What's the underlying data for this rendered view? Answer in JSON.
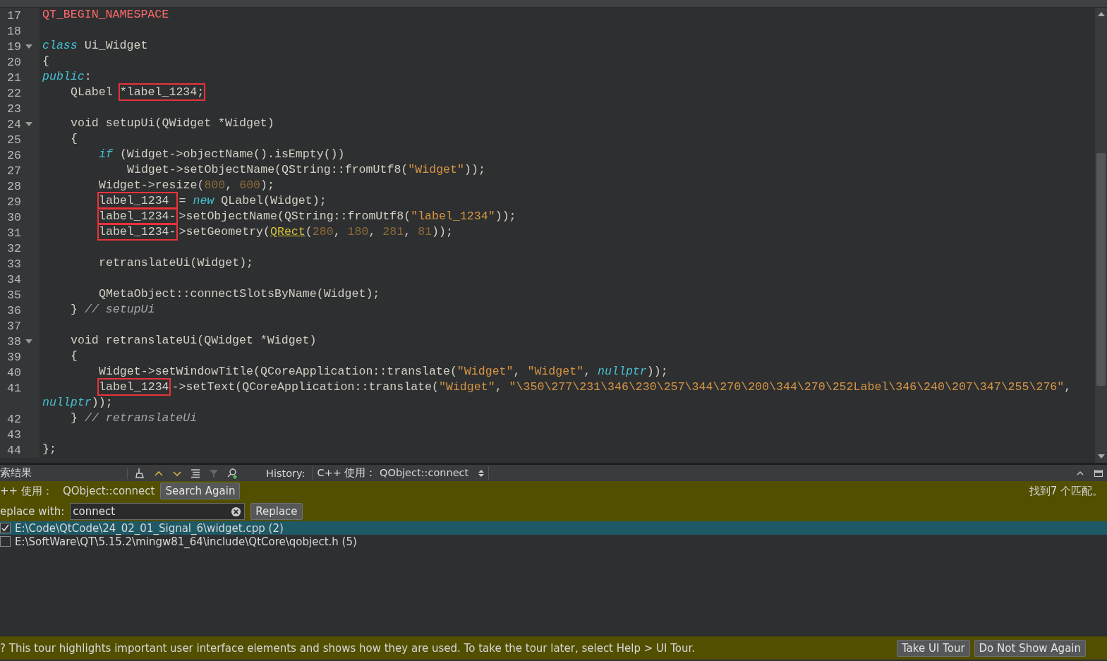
{
  "editor": {
    "lines": [
      {
        "number": "17",
        "foldable": false,
        "kind": "top",
        "tokens": [
          {
            "text": "QT_BEGIN_NAMESPACE",
            "kind": "macro"
          }
        ]
      },
      {
        "number": "18",
        "foldable": false
      },
      {
        "number": "19",
        "foldable": true,
        "kind": "top",
        "tokens": [
          {
            "text": "class",
            "kind": "keyword"
          },
          {
            "text": " Ui_Widget",
            "kind": "plain"
          }
        ]
      },
      {
        "number": "20",
        "foldable": false,
        "kind": "top",
        "tokens": [
          {
            "text": "{",
            "kind": "plain"
          }
        ]
      },
      {
        "number": "21",
        "foldable": false,
        "kind": "top",
        "tokens": [
          {
            "text": "public",
            "kind": "keyword"
          },
          {
            "text": ":",
            "kind": "plain"
          }
        ]
      },
      {
        "number": "22",
        "foldable": false,
        "kind": "member",
        "tokens": [
          {
            "text": "QLabel ",
            "kind": "plain"
          },
          {
            "text": "*label_1234;",
            "kind": "plain",
            "boxed": true
          }
        ]
      },
      {
        "number": "23",
        "foldable": false
      },
      {
        "number": "24",
        "foldable": true,
        "kind": "member",
        "tokens": [
          {
            "text": "void setupUi(QWidget *Widget)",
            "kind": "plain"
          }
        ]
      },
      {
        "number": "25",
        "foldable": false,
        "kind": "member",
        "tokens": [
          {
            "text": "{",
            "kind": "plain"
          }
        ]
      },
      {
        "number": "26",
        "foldable": false,
        "kind": "body",
        "tokens": [
          {
            "text": "if",
            "kind": "keyword"
          },
          {
            "text": " (Widget->objectName().isEmpty())",
            "kind": "plain"
          }
        ]
      },
      {
        "number": "27",
        "foldable": false,
        "kind": "nested",
        "tokens": [
          {
            "text": "Widget->setObjectName(QString::fromUtf8(",
            "kind": "plain"
          },
          {
            "text": "\"Widget\"",
            "kind": "string"
          },
          {
            "text": "));",
            "kind": "plain"
          }
        ]
      },
      {
        "number": "28",
        "foldable": false,
        "kind": "body",
        "tokens": [
          {
            "text": "Widget->resize(",
            "kind": "plain"
          },
          {
            "text": "800",
            "kind": "number"
          },
          {
            "text": ", ",
            "kind": "plain"
          },
          {
            "text": "600",
            "kind": "number"
          },
          {
            "text": ");",
            "kind": "plain"
          }
        ]
      },
      {
        "number": "29",
        "foldable": false,
        "kind": "body",
        "tokens": [
          {
            "text": "label_1234 ",
            "kind": "plain",
            "boxed": true
          },
          {
            "text": "= ",
            "kind": "plain"
          },
          {
            "text": "new",
            "kind": "keyword"
          },
          {
            "text": " QLabel(Widget);",
            "kind": "plain"
          }
        ]
      },
      {
        "number": "30",
        "foldable": false,
        "kind": "body",
        "tokens": [
          {
            "text": "label_1234-",
            "kind": "plain",
            "boxed": true
          },
          {
            "text": ">setObjectName(QString::fromUtf8(",
            "kind": "plain"
          },
          {
            "text": "\"label_1234\"",
            "kind": "string"
          },
          {
            "text": "));",
            "kind": "plain"
          }
        ]
      },
      {
        "number": "31",
        "foldable": false,
        "kind": "body",
        "tokens": [
          {
            "text": "label_1234-",
            "kind": "plain",
            "boxed": true
          },
          {
            "text": ">setGeometry(",
            "kind": "plain"
          },
          {
            "text": "QRect",
            "kind": "link"
          },
          {
            "text": "(",
            "kind": "plain"
          },
          {
            "text": "280",
            "kind": "number"
          },
          {
            "text": ", ",
            "kind": "plain"
          },
          {
            "text": "180",
            "kind": "number"
          },
          {
            "text": ", ",
            "kind": "plain"
          },
          {
            "text": "281",
            "kind": "number"
          },
          {
            "text": ", ",
            "kind": "plain"
          },
          {
            "text": "81",
            "kind": "number"
          },
          {
            "text": "));",
            "kind": "plain"
          }
        ]
      },
      {
        "number": "32",
        "foldable": false
      },
      {
        "number": "33",
        "foldable": false,
        "kind": "body",
        "tokens": [
          {
            "text": "retranslateUi(Widget);",
            "kind": "plain"
          }
        ]
      },
      {
        "number": "34",
        "foldable": false
      },
      {
        "number": "35",
        "foldable": false,
        "kind": "body",
        "tokens": [
          {
            "text": "QMetaObject::connectSlotsByName(Widget);",
            "kind": "plain"
          }
        ]
      },
      {
        "number": "36",
        "foldable": false,
        "kind": "member",
        "tokens": [
          {
            "text": "} ",
            "kind": "plain"
          },
          {
            "text": "// setupUi",
            "kind": "comment"
          }
        ]
      },
      {
        "number": "37",
        "foldable": false
      },
      {
        "number": "38",
        "foldable": true,
        "kind": "member",
        "tokens": [
          {
            "text": "void retranslateUi(QWidget *Widget)",
            "kind": "plain"
          }
        ]
      },
      {
        "number": "39",
        "foldable": false,
        "kind": "member",
        "tokens": [
          {
            "text": "{",
            "kind": "plain"
          }
        ]
      },
      {
        "number": "40",
        "foldable": false,
        "kind": "body",
        "tokens": [
          {
            "text": "Widget->setWindowTitle(QCoreApplication::translate(",
            "kind": "plain"
          },
          {
            "text": "\"Widget\"",
            "kind": "string"
          },
          {
            "text": ", ",
            "kind": "plain"
          },
          {
            "text": "\"Widget\"",
            "kind": "string"
          },
          {
            "text": ", ",
            "kind": "plain"
          },
          {
            "text": "nullptr",
            "kind": "keyword"
          },
          {
            "text": "));",
            "kind": "plain"
          }
        ]
      },
      {
        "number": "41",
        "foldable": false,
        "kind": "body",
        "tokens": [
          {
            "text": "label_1234",
            "kind": "plain",
            "boxed": true
          },
          {
            "text": "->setText(QCoreApplication::translate(",
            "kind": "plain"
          },
          {
            "text": "\"Widget\"",
            "kind": "string"
          },
          {
            "text": ", ",
            "kind": "plain"
          },
          {
            "text": "\"\\350\\277\\231\\346\\230\\257\\344\\270\\200\\344\\270\\252Label\\346\\240\\207\\347\\255\\276\"",
            "kind": "string"
          },
          {
            "text": ",",
            "kind": "plain"
          }
        ]
      },
      {
        "foldable": false,
        "kind": "top",
        "tokens": [
          {
            "text": "nullptr",
            "kind": "keyword"
          },
          {
            "text": "));",
            "kind": "plain"
          }
        ]
      },
      {
        "number": "42",
        "foldable": false,
        "kind": "member",
        "tokens": [
          {
            "text": "} ",
            "kind": "plain"
          },
          {
            "text": "// retranslateUi",
            "kind": "comment"
          }
        ]
      },
      {
        "number": "43",
        "foldable": false
      },
      {
        "number": "44",
        "foldable": false,
        "kind": "top",
        "tokens": [
          {
            "text": "};",
            "kind": "plain"
          }
        ]
      }
    ]
  },
  "search_panel": {
    "title": "索结果",
    "history_label": "History:",
    "history_value": "C++ 使用： QObject::connect",
    "query_label": "++ 使用：",
    "query": "QObject::connect",
    "search_again": "Search Again",
    "match_count": "找到7 个匹配。",
    "replace_label": "eplace with:",
    "replace_value": "connect",
    "replace_button": "Replace",
    "results": [
      {
        "path": "E:\\Code\\QtCode\\24_02_01_Signal_6\\widget.cpp (2)",
        "checked": true,
        "selected": true
      },
      {
        "path": "E:\\SoftWare\\QT\\5.15.2\\mingw81_64\\include\\QtCore\\qobject.h (5)",
        "checked": false,
        "selected": false
      }
    ]
  },
  "tour_bar": {
    "message": "? This tour highlights important user interface elements and shows how they are used. To take the tour later, select Help > UI Tour.",
    "buttons": [
      "Take UI Tour",
      "Do Not Show Again"
    ]
  }
}
